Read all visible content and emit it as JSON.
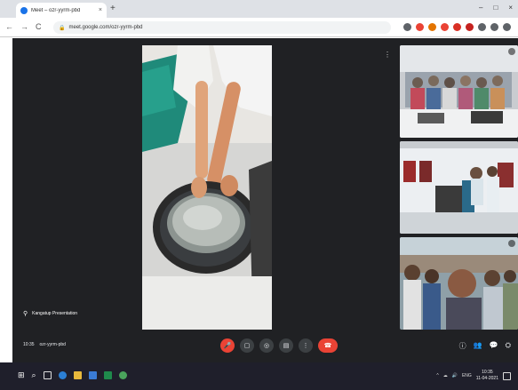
{
  "browser": {
    "tab_title": "Meet – ozr-yyrm-pbd",
    "tab_close": "×",
    "new_tab": "+",
    "window_controls": [
      "–",
      "□",
      "×"
    ],
    "nav": [
      "←",
      "→",
      "C"
    ],
    "url": "meet.google.com/ozr-yyrm-pbd",
    "ext_colors": [
      "#5f6368",
      "#ea4335",
      "#e37400",
      "#ea4335",
      "#d93025",
      "#c5221f",
      "#5f6368",
      "#5f6368",
      "#5f6368"
    ]
  },
  "meet": {
    "presenter_name": "Kangatup Presentation",
    "more_menu": "⋮",
    "meeting_time": "10:35",
    "meeting_code": "ozr-yyrm-pbd",
    "controls": {
      "mic": "🎤",
      "camera": "▢",
      "captions": "◎",
      "present": "▤",
      "more": "⋮",
      "hangup": "☎"
    },
    "right_controls": [
      "ⓘ",
      "👥",
      "💬",
      "⛭"
    ]
  },
  "taskbar": {
    "start": "⊞",
    "search": "⌕",
    "time": "10:35",
    "date": "11-04-2021",
    "tray": [
      "^",
      "☁",
      "🔊",
      "ENG"
    ]
  }
}
